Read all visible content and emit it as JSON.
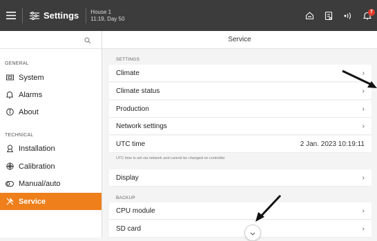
{
  "topbar": {
    "title": "Settings",
    "house_name": "House 1",
    "house_time": "11:19, Day 50",
    "alarm_count": "7",
    "icons": [
      "menu-icon",
      "sliders-icon",
      "house-icon",
      "report-icon",
      "signal-icon",
      "bell-icon"
    ]
  },
  "sidebar": {
    "groups": [
      {
        "label": "GENERAL",
        "items": [
          {
            "label": "System",
            "icon": "monitor-icon"
          },
          {
            "label": "Alarms",
            "icon": "bell-icon"
          },
          {
            "label": "About",
            "icon": "info-icon"
          }
        ]
      },
      {
        "label": "TECHNICAL",
        "items": [
          {
            "label": "Installation",
            "icon": "installation-icon"
          },
          {
            "label": "Calibration",
            "icon": "calibration-icon"
          },
          {
            "label": "Manual/auto",
            "icon": "toggle-icon"
          },
          {
            "label": "Service",
            "icon": "wrench-icon",
            "active": true
          }
        ]
      }
    ]
  },
  "main": {
    "title": "Service",
    "sections": [
      {
        "label": "SETTINGS",
        "rows": [
          "Climate",
          "Climate status",
          "Production",
          "Network settings"
        ]
      },
      {
        "label": "BACKUP",
        "rows": [
          "CPU module",
          "SD card"
        ]
      }
    ],
    "utc_label": "UTC time",
    "utc_value": "2 Jan. 2023 10:19:11",
    "utc_hint": "UTC time is set via network and cannot be changed on controller",
    "display_label": "Display"
  },
  "colors": {
    "topbar": "#3c3c3c",
    "accent": "#ee7f1a",
    "badge": "#e53c2e"
  }
}
